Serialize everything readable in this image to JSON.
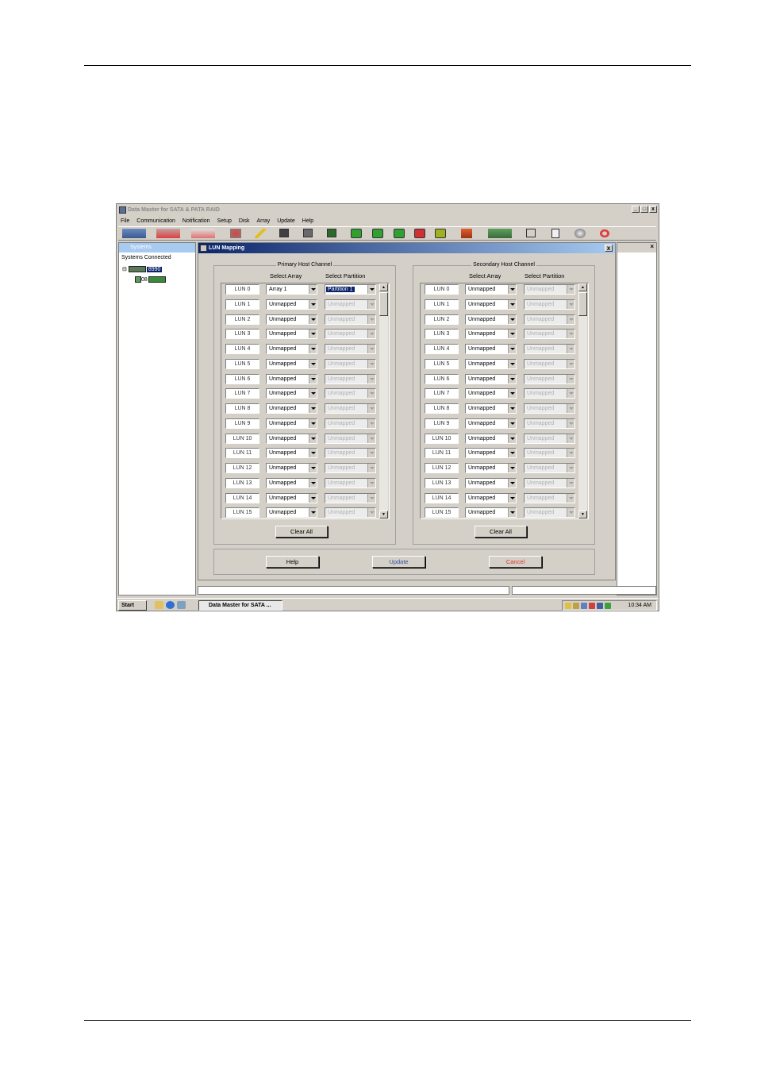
{
  "window": {
    "title": "Data Master for SATA & PATA RAID",
    "controls": [
      "_",
      "□",
      "x"
    ]
  },
  "menu": [
    "File",
    "Communication",
    "Notification",
    "Setup",
    "Disk",
    "Array",
    "Update",
    "Help"
  ],
  "left_pane": {
    "header": "Systems",
    "heading": "Systems Connected",
    "tree": [
      {
        "label": "8990",
        "selected": true
      },
      {
        "label": "08"
      }
    ]
  },
  "dialog": {
    "title": "LUN Mapping",
    "close": "x",
    "column_select_array": "Select Array",
    "column_select_partition": "Select Partition",
    "primary": {
      "title": "Primary Host Channel",
      "rows": [
        {
          "lun": "LUN 0",
          "array": "Array 1",
          "partition": "Partition 1"
        },
        {
          "lun": "LUN 1",
          "array": "Unmapped",
          "partition": "Unmapped"
        },
        {
          "lun": "LUN 2",
          "array": "Unmapped",
          "partition": "Unmapped"
        },
        {
          "lun": "LUN 3",
          "array": "Unmapped",
          "partition": "Unmapped"
        },
        {
          "lun": "LUN 4",
          "array": "Unmapped",
          "partition": "Unmapped"
        },
        {
          "lun": "LUN 5",
          "array": "Unmapped",
          "partition": "Unmapped"
        },
        {
          "lun": "LUN 6",
          "array": "Unmapped",
          "partition": "Unmapped"
        },
        {
          "lun": "LUN 7",
          "array": "Unmapped",
          "partition": "Unmapped"
        },
        {
          "lun": "LUN 8",
          "array": "Unmapped",
          "partition": "Unmapped"
        },
        {
          "lun": "LUN 9",
          "array": "Unmapped",
          "partition": "Unmapped"
        },
        {
          "lun": "LUN 10",
          "array": "Unmapped",
          "partition": "Unmapped"
        },
        {
          "lun": "LUN 11",
          "array": "Unmapped",
          "partition": "Unmapped"
        },
        {
          "lun": "LUN 12",
          "array": "Unmapped",
          "partition": "Unmapped"
        },
        {
          "lun": "LUN 13",
          "array": "Unmapped",
          "partition": "Unmapped"
        },
        {
          "lun": "LUN 14",
          "array": "Unmapped",
          "partition": "Unmapped"
        },
        {
          "lun": "LUN 15",
          "array": "Unmapped",
          "partition": "Unmapped"
        }
      ],
      "clear_all": "Clear All"
    },
    "secondary": {
      "title": "Secondary Host Channel",
      "rows": [
        {
          "lun": "LUN 0",
          "array": "Unmapped",
          "partition": "Unmapped"
        },
        {
          "lun": "LUN 1",
          "array": "Unmapped",
          "partition": "Unmapped"
        },
        {
          "lun": "LUN 2",
          "array": "Unmapped",
          "partition": "Unmapped"
        },
        {
          "lun": "LUN 3",
          "array": "Unmapped",
          "partition": "Unmapped"
        },
        {
          "lun": "LUN 4",
          "array": "Unmapped",
          "partition": "Unmapped"
        },
        {
          "lun": "LUN 5",
          "array": "Unmapped",
          "partition": "Unmapped"
        },
        {
          "lun": "LUN 6",
          "array": "Unmapped",
          "partition": "Unmapped"
        },
        {
          "lun": "LUN 7",
          "array": "Unmapped",
          "partition": "Unmapped"
        },
        {
          "lun": "LUN 8",
          "array": "Unmapped",
          "partition": "Unmapped"
        },
        {
          "lun": "LUN 9",
          "array": "Unmapped",
          "partition": "Unmapped"
        },
        {
          "lun": "LUN 10",
          "array": "Unmapped",
          "partition": "Unmapped"
        },
        {
          "lun": "LUN 11",
          "array": "Unmapped",
          "partition": "Unmapped"
        },
        {
          "lun": "LUN 12",
          "array": "Unmapped",
          "partition": "Unmapped"
        },
        {
          "lun": "LUN 13",
          "array": "Unmapped",
          "partition": "Unmapped"
        },
        {
          "lun": "LUN 14",
          "array": "Unmapped",
          "partition": "Unmapped"
        },
        {
          "lun": "LUN 15",
          "array": "Unmapped",
          "partition": "Unmapped"
        }
      ],
      "clear_all": "Clear All"
    },
    "buttons": {
      "help": "Help",
      "update": "Update",
      "cancel": "Cancel"
    }
  },
  "taskbar": {
    "start": "Start",
    "task": "Data Master for SATA ...",
    "clock": "10:34 AM"
  },
  "colors": {
    "update_text": "#3050a0",
    "cancel_text": "#e03030",
    "dialog_title_bg": "#0a246a",
    "face": "#d4d0c8"
  }
}
